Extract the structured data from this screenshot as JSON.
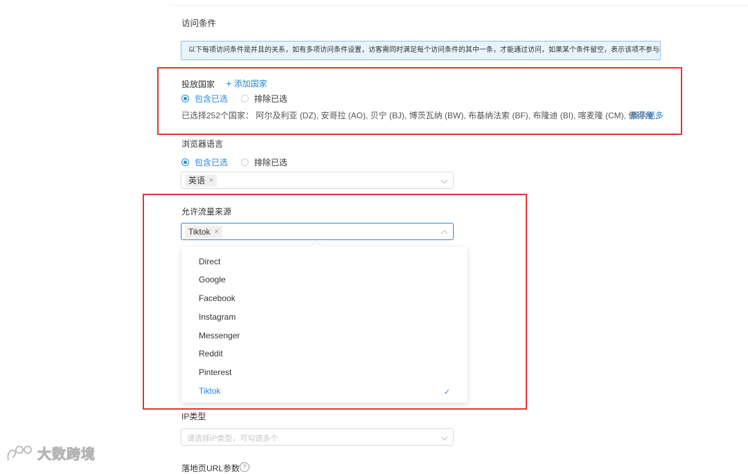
{
  "access": {
    "title": "访问条件",
    "notice": "以下每项访问条件是并且的关系，如有多项访问条件设置，访客需同时满足每个访问条件的其中一条，才能通过访问，如果某个条件留空，表示该项不参与验证。"
  },
  "country": {
    "label": "投放国家",
    "add_label": "添加国家",
    "include_label": "包含已选",
    "exclude_label": "排除已选",
    "selected_text": "已选择252个国家：  阿尔及利亚 (DZ), 安哥拉 (AO), 贝宁 (BJ), 博茨瓦纳 (BW), 布基纳法索 (BF), 布隆迪 (BI), 喀麦隆 (CM), 佛得角...",
    "show_more": "展示更多"
  },
  "browser_language": {
    "label": "浏览器语言",
    "include_label": "包含已选",
    "exclude_label": "排除已选",
    "tag": "英语",
    "tag_remove": "×"
  },
  "traffic_source": {
    "label": "允许流量来源",
    "tag": "Tiktok",
    "tag_remove": "×",
    "options": [
      "Direct",
      "Google",
      "Facebook",
      "Instagram",
      "Messenger",
      "Reddit",
      "Pinterest",
      "Tiktok"
    ],
    "selected": "Tiktok",
    "check": "✓"
  },
  "ip_type": {
    "label": "IP类型",
    "placeholder": "请选择IP类型，可勾选多个"
  },
  "landing_url": {
    "label": "落地页URL参数",
    "help": "?"
  },
  "watermark": {
    "text": "大数跨境"
  },
  "colors": {
    "accent": "#2a86e0",
    "highlight_box": "#e03434",
    "notice_bg": "#e9f3fd"
  }
}
